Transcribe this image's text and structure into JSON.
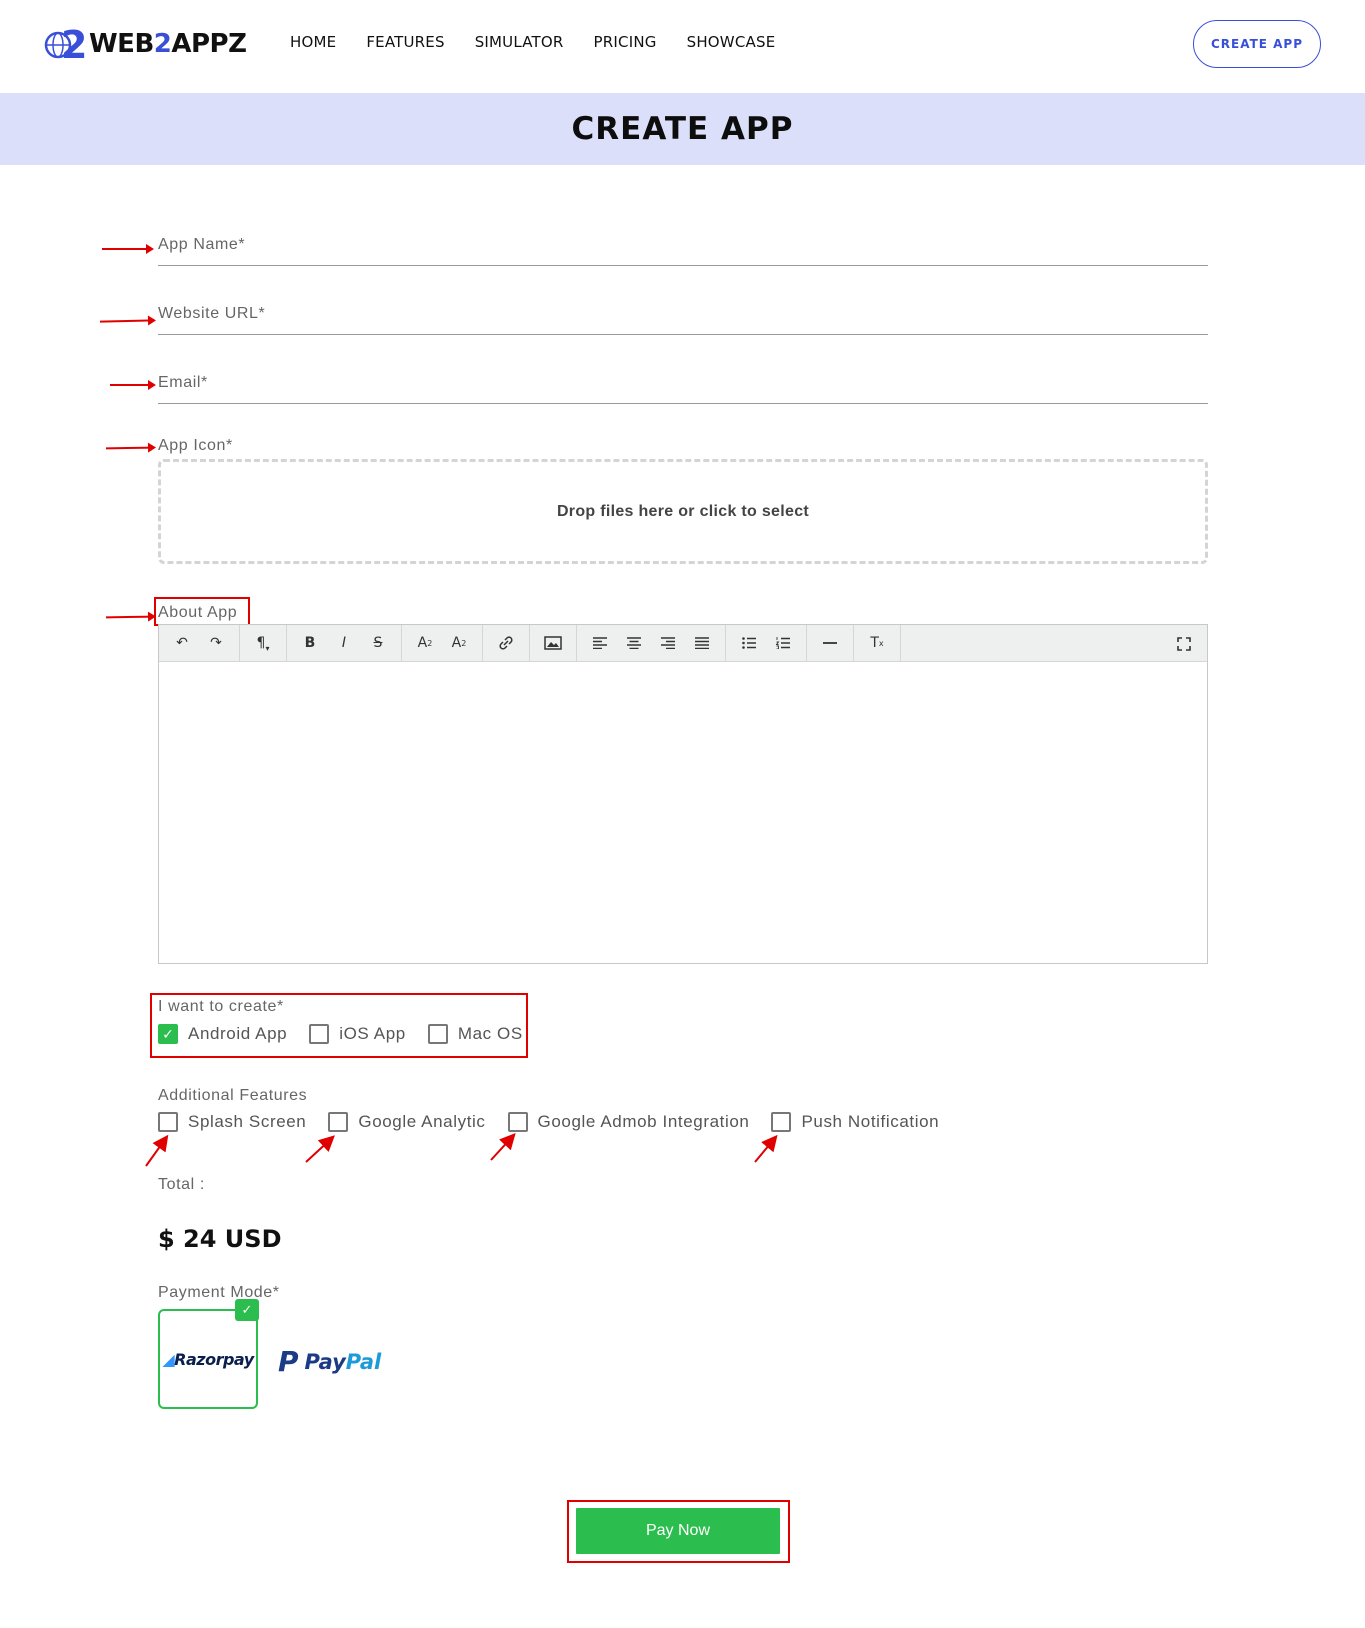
{
  "header": {
    "logo_mark": "2",
    "logo_text_a": "WEB",
    "logo_text_b": "2",
    "logo_text_c": "APPZ",
    "nav": [
      "HOME",
      "FEATURES",
      "SIMULATOR",
      "PRICING",
      "SHOWCASE"
    ],
    "cta_label": "CREATE APP"
  },
  "banner": {
    "title": "CREATE APP"
  },
  "form": {
    "app_name_label": "App Name*",
    "website_url_label": "Website URL*",
    "email_label": "Email*",
    "app_icon_label": "App Icon*",
    "dropzone_text": "Drop files here or click to select",
    "about_label": "About App",
    "create_label": "I want to create*",
    "platforms": [
      {
        "label": "Android App",
        "checked": true
      },
      {
        "label": "iOS App",
        "checked": false
      },
      {
        "label": "Mac OS",
        "checked": false
      }
    ],
    "features_label": "Additional Features",
    "features": [
      {
        "label": "Splash Screen",
        "checked": false
      },
      {
        "label": "Google Analytic",
        "checked": false
      },
      {
        "label": "Google Admob Integration",
        "checked": false
      },
      {
        "label": "Push Notification",
        "checked": false
      }
    ],
    "total_label": "Total :",
    "total_amount": "$ 24 USD",
    "payment_label": "Payment Mode*",
    "payment_options": [
      {
        "label": "Razorpay",
        "selected": true
      },
      {
        "label": "PayPal",
        "selected": false
      }
    ],
    "paypal_a": "Pay",
    "paypal_b": "Pal",
    "pay_now_label": "Pay Now"
  },
  "colors": {
    "brand_blue": "#3a4fd8",
    "banner_bg": "#dcdff9",
    "success_green": "#2bbd4e",
    "annotation_red": "#e00000"
  },
  "icons": {
    "undo": "undo-icon",
    "redo": "redo-icon",
    "paragraph": "paragraph-icon",
    "bold": "bold-icon",
    "italic": "italic-icon",
    "strike": "strikethrough-icon",
    "superscript": "superscript-icon",
    "subscript": "subscript-icon",
    "link": "link-icon",
    "image": "image-icon",
    "align_left": "align-left-icon",
    "align_center": "align-center-icon",
    "align_right": "align-right-icon",
    "justify": "justify-icon",
    "bullet_list": "bullet-list-icon",
    "numbered_list": "numbered-list-icon",
    "hr": "horizontal-rule-icon",
    "clear_format": "clear-format-icon",
    "fullscreen": "fullscreen-icon"
  }
}
